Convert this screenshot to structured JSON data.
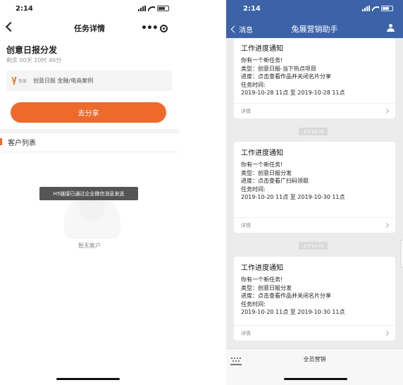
{
  "left": {
    "status": {
      "time": "2:14"
    },
    "nav": {
      "title": "任务详情",
      "more": "•••"
    },
    "task": {
      "title": "创意日报分发",
      "countdown": "剩余 00天 20时 46分",
      "logo_text": "兔展",
      "creative_text": "创意日报  金融/电商案例",
      "share_label": "去分享"
    },
    "section_title": "客户列表",
    "toast": "H5链接已通过企业微信消息发送",
    "empty_text": "暂无客户"
  },
  "right": {
    "status": {
      "time": "2:14"
    },
    "nav": {
      "back": "消息",
      "title": "兔展营销助手"
    },
    "messages": [
      {
        "title": "工作进度通知",
        "lines": [
          "你有一个新任务!",
          "类型：创意日报-当下热点项目",
          "进度：点击查看作品并关闭名片分享",
          "任务时间:",
          "2019-10-28 11点 至 2019-10-28 11点"
        ],
        "detail": "详情"
      },
      {
        "title": "工作进度通知",
        "lines": [
          "你有一个新任务!",
          "类型：创意日报分发",
          "进度：点击查看广扫码领取",
          "任务时间:",
          "2019-10-20 11点 至 2019-10-30 11点"
        ],
        "detail": "详情"
      },
      {
        "title": "工作进度通知",
        "lines": [
          "你有一个新任务!",
          "类型：创意日报分发",
          "进度：点击查看作品并关闭名片分享",
          "任务时间:",
          "2019-10-20 11点 至 2019-10-30 11点"
        ],
        "detail": "详情"
      }
    ],
    "time_pills": [
      "上午10:38",
      "上午10:41"
    ],
    "bottom_menu": "全员营销"
  }
}
